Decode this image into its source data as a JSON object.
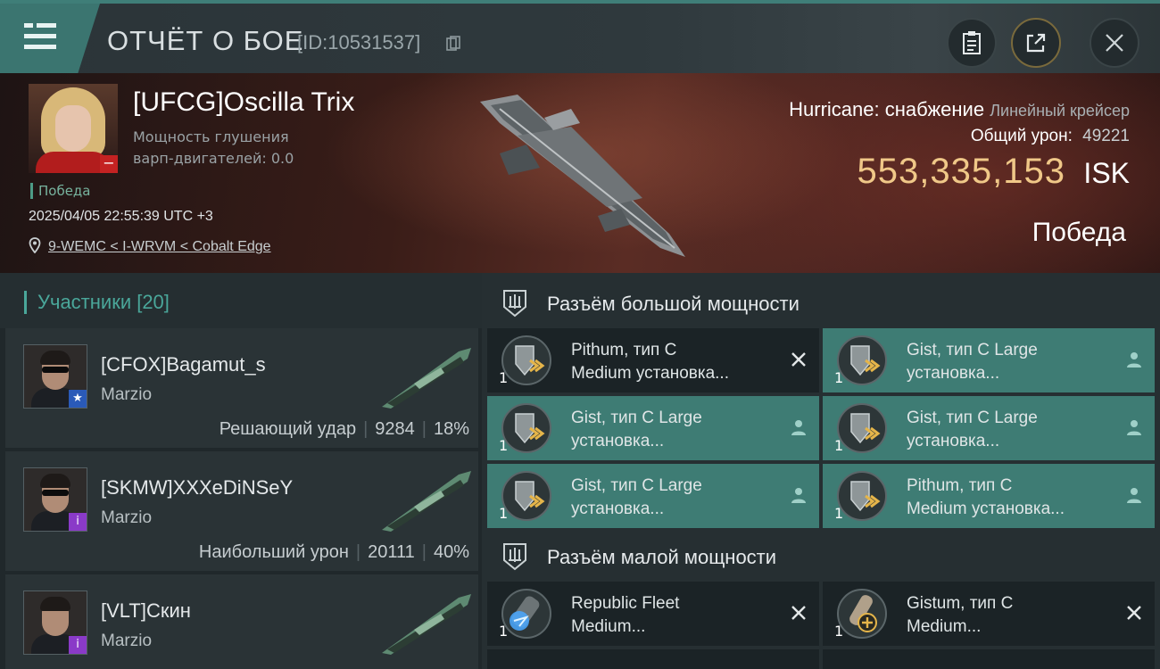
{
  "header": {
    "title": "ОТЧЁТ О БОЕ",
    "report_id": "[ID:10531537]"
  },
  "victim": {
    "name": "[UFCG]Oscilla Trix",
    "warp_jam": "Мощность глушения варп-двигателей: 0.0",
    "status_tag": "Победа",
    "datetime": "2025/04/05 22:55:39 UTC +3",
    "location": "9-WEMC < I-WRVM < Cobalt Edge",
    "ship_name": "Hurricane: снабжение",
    "ship_class": "Линейный крейсер",
    "total_damage_label": "Общий урон:",
    "total_damage": "49221",
    "isk_value": "553,335,153",
    "isk_unit": "ISK",
    "result": "Победа"
  },
  "participants": {
    "title": "Участники [20]",
    "items": [
      {
        "name": "[CFOX]Bagamut_s",
        "ship": "Marzio",
        "role": "Решающий удар",
        "damage": "9284",
        "percent": "18%",
        "badge_color": "#2a5ab8"
      },
      {
        "name": "[SKMW]XXXeDiNSeY",
        "ship": "Marzio",
        "role": "Наибольший урон",
        "damage": "20111",
        "percent": "40%",
        "badge_color": "#8a3ac8"
      },
      {
        "name": "[VLT]Скин",
        "ship": "Marzio",
        "role": "",
        "damage": "",
        "percent": "",
        "badge_color": "#8a3ac8"
      }
    ]
  },
  "fitting": {
    "high_slots_title": "Разъём большой мощности",
    "low_slots_title": "Разъём малой мощности",
    "high_slots": [
      {
        "name1": "Pithum, тип C",
        "name2": "Medium установка...",
        "qty": "1",
        "state": "destroyed",
        "icon": "shield-booster-icon"
      },
      {
        "name1": "Gist, тип C Large",
        "name2": "установка...",
        "qty": "1",
        "state": "dropped",
        "icon": "shield-booster-icon"
      },
      {
        "name1": "Gist, тип C Large",
        "name2": "установка...",
        "qty": "1",
        "state": "dropped",
        "icon": "shield-booster-icon"
      },
      {
        "name1": "Gist, тип C Large",
        "name2": "установка...",
        "qty": "1",
        "state": "dropped",
        "icon": "shield-booster-icon"
      },
      {
        "name1": "Gist, тип C Large",
        "name2": "установка...",
        "qty": "1",
        "state": "dropped",
        "icon": "shield-booster-icon"
      },
      {
        "name1": "Pithum, тип C",
        "name2": "Medium установка...",
        "qty": "1",
        "state": "dropped",
        "icon": "shield-booster-icon"
      }
    ],
    "low_slots": [
      {
        "name1": "Republic Fleet",
        "name2": "Medium...",
        "qty": "1",
        "state": "destroyed",
        "icon": "capacitor-icon"
      },
      {
        "name1": "Gistum, тип C",
        "name2": "Medium...",
        "qty": "1",
        "state": "destroyed",
        "icon": "shield-extender-icon"
      }
    ]
  },
  "colors": {
    "accent_teal": "#3e7c74",
    "isk_gold": "#f0c888"
  }
}
